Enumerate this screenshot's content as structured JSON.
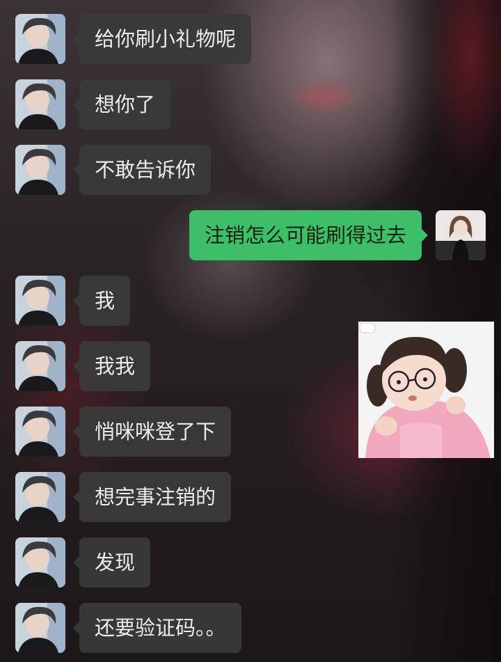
{
  "messages": [
    {
      "side": "in",
      "text": "给你刷小礼物呢"
    },
    {
      "side": "in",
      "text": "想你了"
    },
    {
      "side": "in",
      "text": "不敢告诉你"
    },
    {
      "side": "out",
      "text": "注销怎么可能刷得过去"
    },
    {
      "side": "in",
      "text": "我"
    },
    {
      "side": "in",
      "text": "我我"
    },
    {
      "side": "in",
      "text": "悄咪咪登了下"
    },
    {
      "side": "in",
      "text": "想完事注销的"
    },
    {
      "side": "in",
      "text": "发现"
    },
    {
      "side": "in",
      "text": "还要验证码。。"
    }
  ],
  "sticker": {
    "icon": "girl-with-glasses-sticker-icon"
  },
  "colors": {
    "outgoing_bubble": "#3dbf6a",
    "incoming_bubble": "#3a3a3a"
  }
}
